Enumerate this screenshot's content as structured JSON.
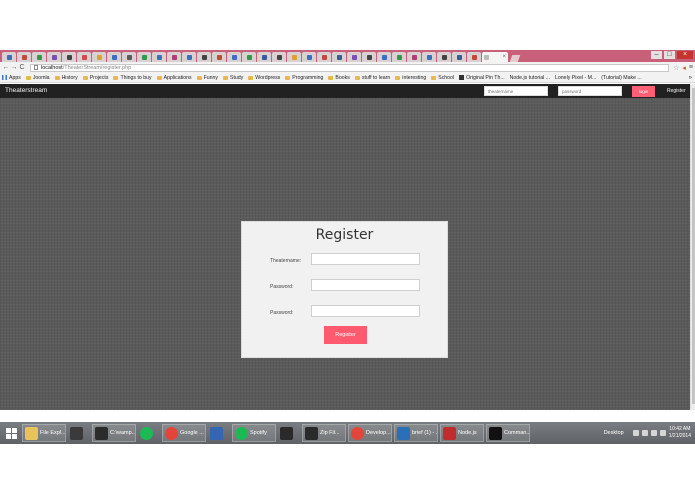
{
  "browser": {
    "tabs": [
      {
        "color": "#3b6fc2"
      },
      {
        "color": "#c04b3a"
      },
      {
        "color": "#2f9a4b"
      },
      {
        "color": "#7a4fb0"
      },
      {
        "color": "#444444"
      },
      {
        "color": "#d24a4a"
      },
      {
        "color": "#e0a030"
      },
      {
        "color": "#3b6fc2"
      },
      {
        "color": "#5b5b5b"
      },
      {
        "color": "#2f9a4b"
      },
      {
        "color": "#3b6fc2"
      },
      {
        "color": "#b03c7a"
      },
      {
        "color": "#3b6fc2"
      },
      {
        "color": "#444444"
      },
      {
        "color": "#c04b3a"
      },
      {
        "color": "#3b6fc2"
      },
      {
        "color": "#2f9a4b"
      },
      {
        "color": "#3b5998"
      },
      {
        "color": "#444444"
      },
      {
        "color": "#e0a030"
      },
      {
        "color": "#3b6fc2"
      },
      {
        "color": "#c04b3a"
      },
      {
        "color": "#3b5998"
      },
      {
        "color": "#7a4fb0"
      },
      {
        "color": "#444444"
      },
      {
        "color": "#3b6fc2"
      },
      {
        "color": "#2f9a4b"
      },
      {
        "color": "#b03c7a"
      },
      {
        "color": "#3b6fc2"
      },
      {
        "color": "#444444"
      },
      {
        "color": "#3b5998"
      },
      {
        "color": "#c04b3a"
      }
    ],
    "active_tab_close": "×",
    "window_controls": {
      "minimize": "–",
      "maximize": "□",
      "close": "×"
    },
    "nav": {
      "back": "←",
      "forward": "→",
      "reload": "C"
    },
    "url_host": "localhost",
    "url_path": "/TheaterStream/register.php",
    "bookmarks": [
      {
        "label": "Apps",
        "icon": "apps-grid-icon"
      },
      {
        "label": "Joomla",
        "icon": "folder-icon"
      },
      {
        "label": "History",
        "icon": "folder-icon"
      },
      {
        "label": "Projects",
        "icon": "folder-icon"
      },
      {
        "label": "Things to buy",
        "icon": "folder-icon"
      },
      {
        "label": "Applications",
        "icon": "folder-icon"
      },
      {
        "label": "Funny",
        "icon": "folder-icon"
      },
      {
        "label": "Study",
        "icon": "folder-icon"
      },
      {
        "label": "Wordpress",
        "icon": "folder-icon"
      },
      {
        "label": "Programming",
        "icon": "folder-icon"
      },
      {
        "label": "Books",
        "icon": "folder-icon"
      },
      {
        "label": "stuff to learn",
        "icon": "folder-icon"
      },
      {
        "label": "interesting",
        "icon": "folder-icon"
      },
      {
        "label": "School",
        "icon": "folder-icon"
      },
      {
        "label": "Original Pin Th...",
        "icon": "site-icon"
      },
      {
        "label": "Node.js tutorial ...",
        "icon": "page-icon"
      },
      {
        "label": "Lonely Pixel - M...",
        "icon": "page-icon"
      },
      {
        "label": "(Tutorial) Make ...",
        "icon": "page-icon"
      }
    ],
    "bookmarks_more": "»"
  },
  "site": {
    "brand": "Theaterstream",
    "nav_theatername_placeholder": "theatername",
    "nav_password_placeholder": "password",
    "nav_login": "login",
    "nav_register": "Register",
    "form": {
      "title": "Register",
      "theatername_label": "Theatername:",
      "password_label": "Password:",
      "password_confirm_label": "Password:",
      "submit": "Register"
    }
  },
  "taskbar": {
    "items": [
      {
        "label": "File Expl...",
        "color": "#e8c35a",
        "round": false
      },
      {
        "label": "",
        "color": "#3a3a3a",
        "round": false
      },
      {
        "label": "C:\\wamp...",
        "color": "#2b2b2b",
        "round": false
      },
      {
        "label": "",
        "color": "#1db954",
        "round": true
      },
      {
        "label": "Google ...",
        "color": "#e4453a",
        "round": true
      },
      {
        "label": "",
        "color": "#3566b6",
        "round": false
      },
      {
        "label": "Spotify",
        "color": "#1db954",
        "round": true
      },
      {
        "label": "",
        "color": "#2a2a2a",
        "round": false
      },
      {
        "label": "Zip Fil...",
        "color": "#2a2a2a",
        "round": false
      },
      {
        "label": "Develop...",
        "color": "#e4453a",
        "round": true
      },
      {
        "label": "brief (1) - ...",
        "color": "#2a6fb8",
        "round": false
      },
      {
        "label": "Node.js",
        "color": "#c02c2c",
        "round": false
      },
      {
        "label": "Comman...",
        "color": "#111111",
        "round": false
      }
    ],
    "desktop": "Desktop",
    "time": "10:42 AM",
    "date": "1/21/2014"
  }
}
